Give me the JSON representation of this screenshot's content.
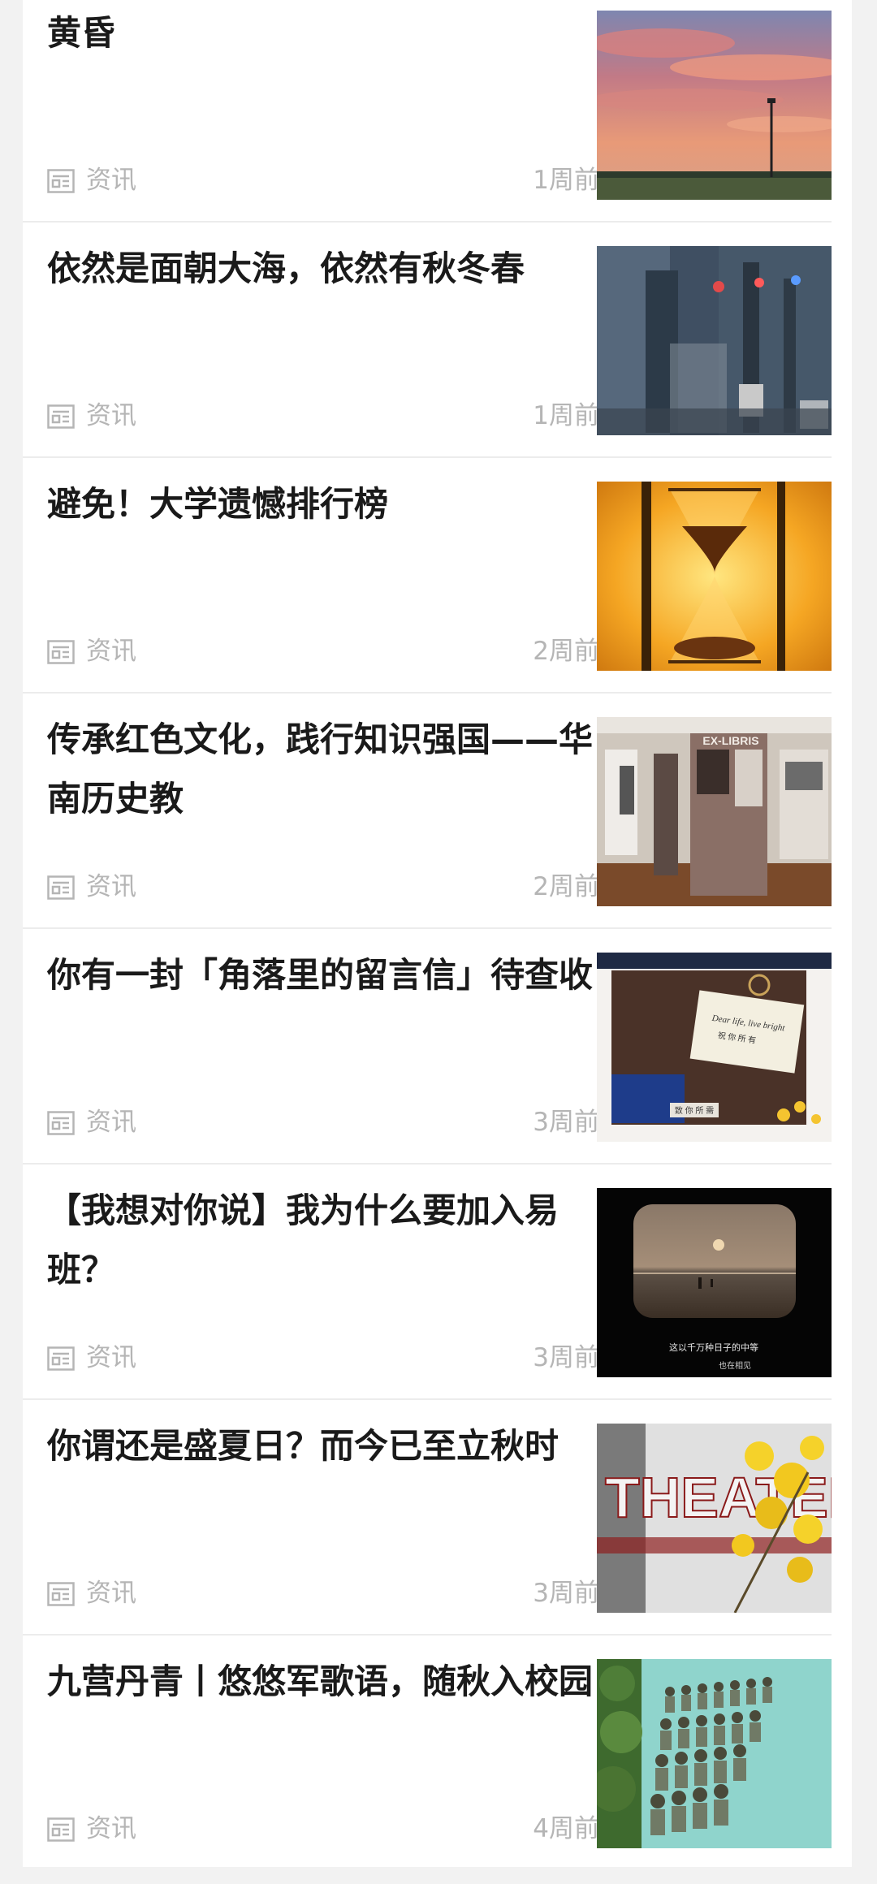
{
  "articles": [
    {
      "title": "黄昏",
      "category": "资讯",
      "time": "1周前",
      "image": "sunset-tower"
    },
    {
      "title": "依然是面朝大海，依然有秋冬春",
      "category": "资讯",
      "time": "1周前",
      "image": "rainy-street"
    },
    {
      "title": "避免！大学遗憾排行榜",
      "category": "资讯",
      "time": "2周前",
      "image": "hourglass"
    },
    {
      "title": "传承红色文化，践行知识强国——华南历史教",
      "category": "资讯",
      "time": "2周前",
      "image": "exhibition-hall"
    },
    {
      "title": "你有一封「角落里的留言信」待查收",
      "category": "资讯",
      "time": "3周前",
      "image": "letter-card"
    },
    {
      "title": "【我想对你说】我为什么要加入易班？",
      "category": "资讯",
      "time": "3周前",
      "image": "sea-window"
    },
    {
      "title": "你谓还是盛夏日？而今已至立秋时",
      "category": "资讯",
      "time": "3周前",
      "image": "theater-flowers"
    },
    {
      "title": "九营丹青丨悠悠军歌语，随秋入校园",
      "category": "资讯",
      "time": "4周前",
      "image": "marching-soldiers"
    }
  ],
  "thumb_texts": {
    "ex_libris": "EX-LIBRIS",
    "letter_line1": "Dear life, live bright",
    "letter_line2": "祝 你 所 有",
    "letter_tag": "致 你 所 需",
    "sea_caption1": "这以千万种日子的中等",
    "sea_caption2": "也在相见",
    "theater": "THEATER"
  },
  "colors": {
    "title": "#1a1a1a",
    "meta": "#b5b5b5",
    "divider": "#ececec",
    "background": "#f2f2f2"
  }
}
